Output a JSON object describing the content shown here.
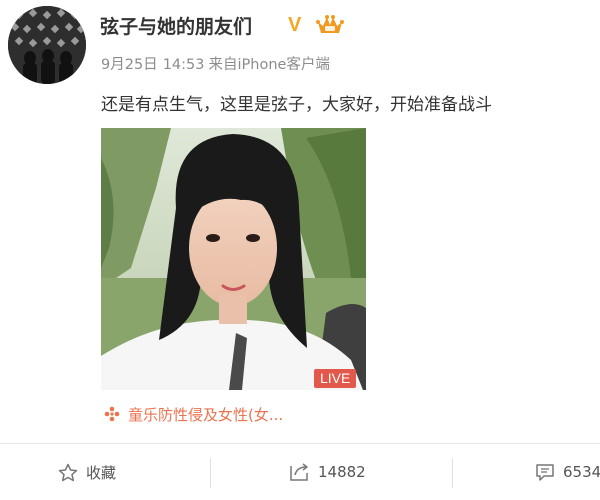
{
  "post": {
    "author_name": "弦子与她的朋友们",
    "verified_badge": "V",
    "timestamp_date": "9月25日",
    "timestamp_time": "14:53",
    "source_prefix": "来自",
    "source_device": "iPhone客户端",
    "text": "还是有点生气，这里是弦子，大家好，开始准备战斗",
    "live_badge": "LIVE",
    "topic_label": "童乐防性侵及女性(女..."
  },
  "actions": {
    "favorite_label": "收藏",
    "repost_count": "14882",
    "comment_count": "6534"
  },
  "colors": {
    "badge_gold": "#f5a623",
    "live_red": "#e2584a",
    "topic_orange": "#eb7350"
  }
}
